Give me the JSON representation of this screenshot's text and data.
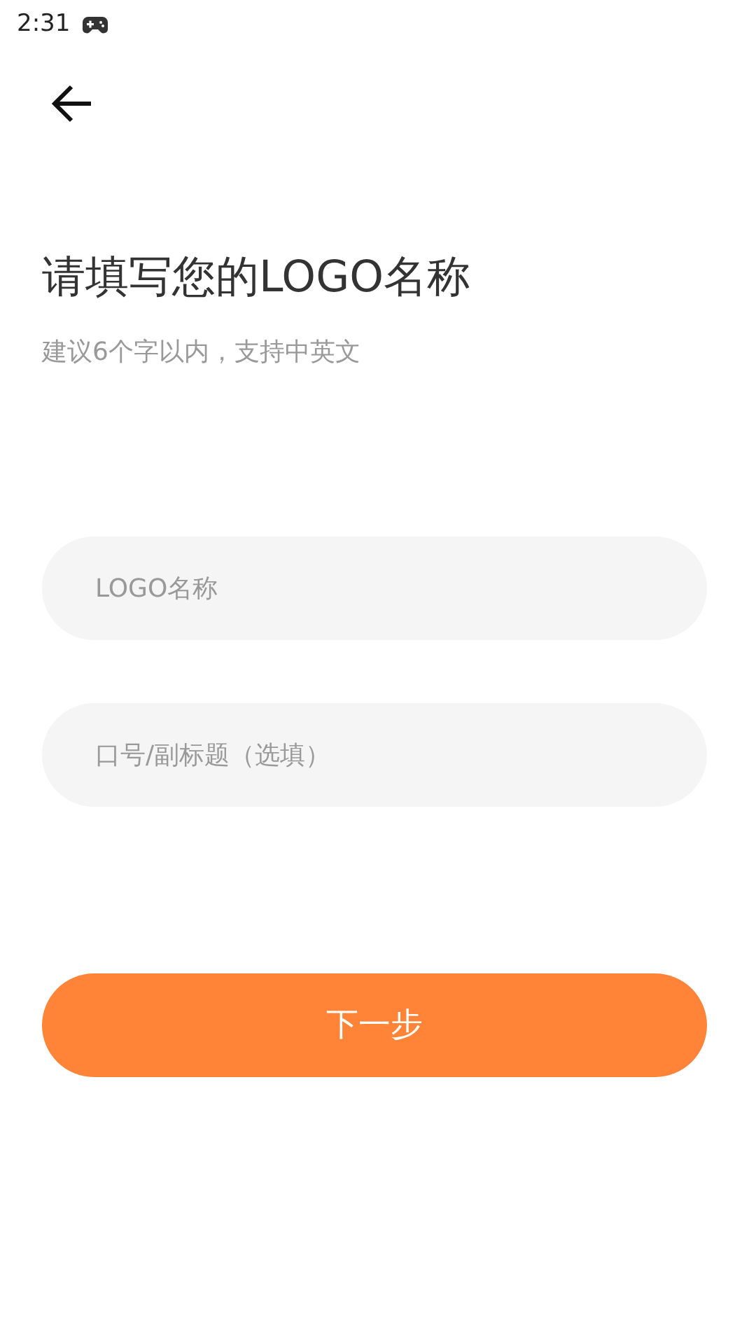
{
  "status_bar": {
    "time": "2:31"
  },
  "title": "请填写您的LOGO名称",
  "subtitle": "建议6个字以内，支持中英文",
  "fields": [
    {
      "placeholder": "LOGO名称"
    },
    {
      "placeholder": "口号/副标题（选填）"
    }
  ],
  "next_button": "下一步"
}
